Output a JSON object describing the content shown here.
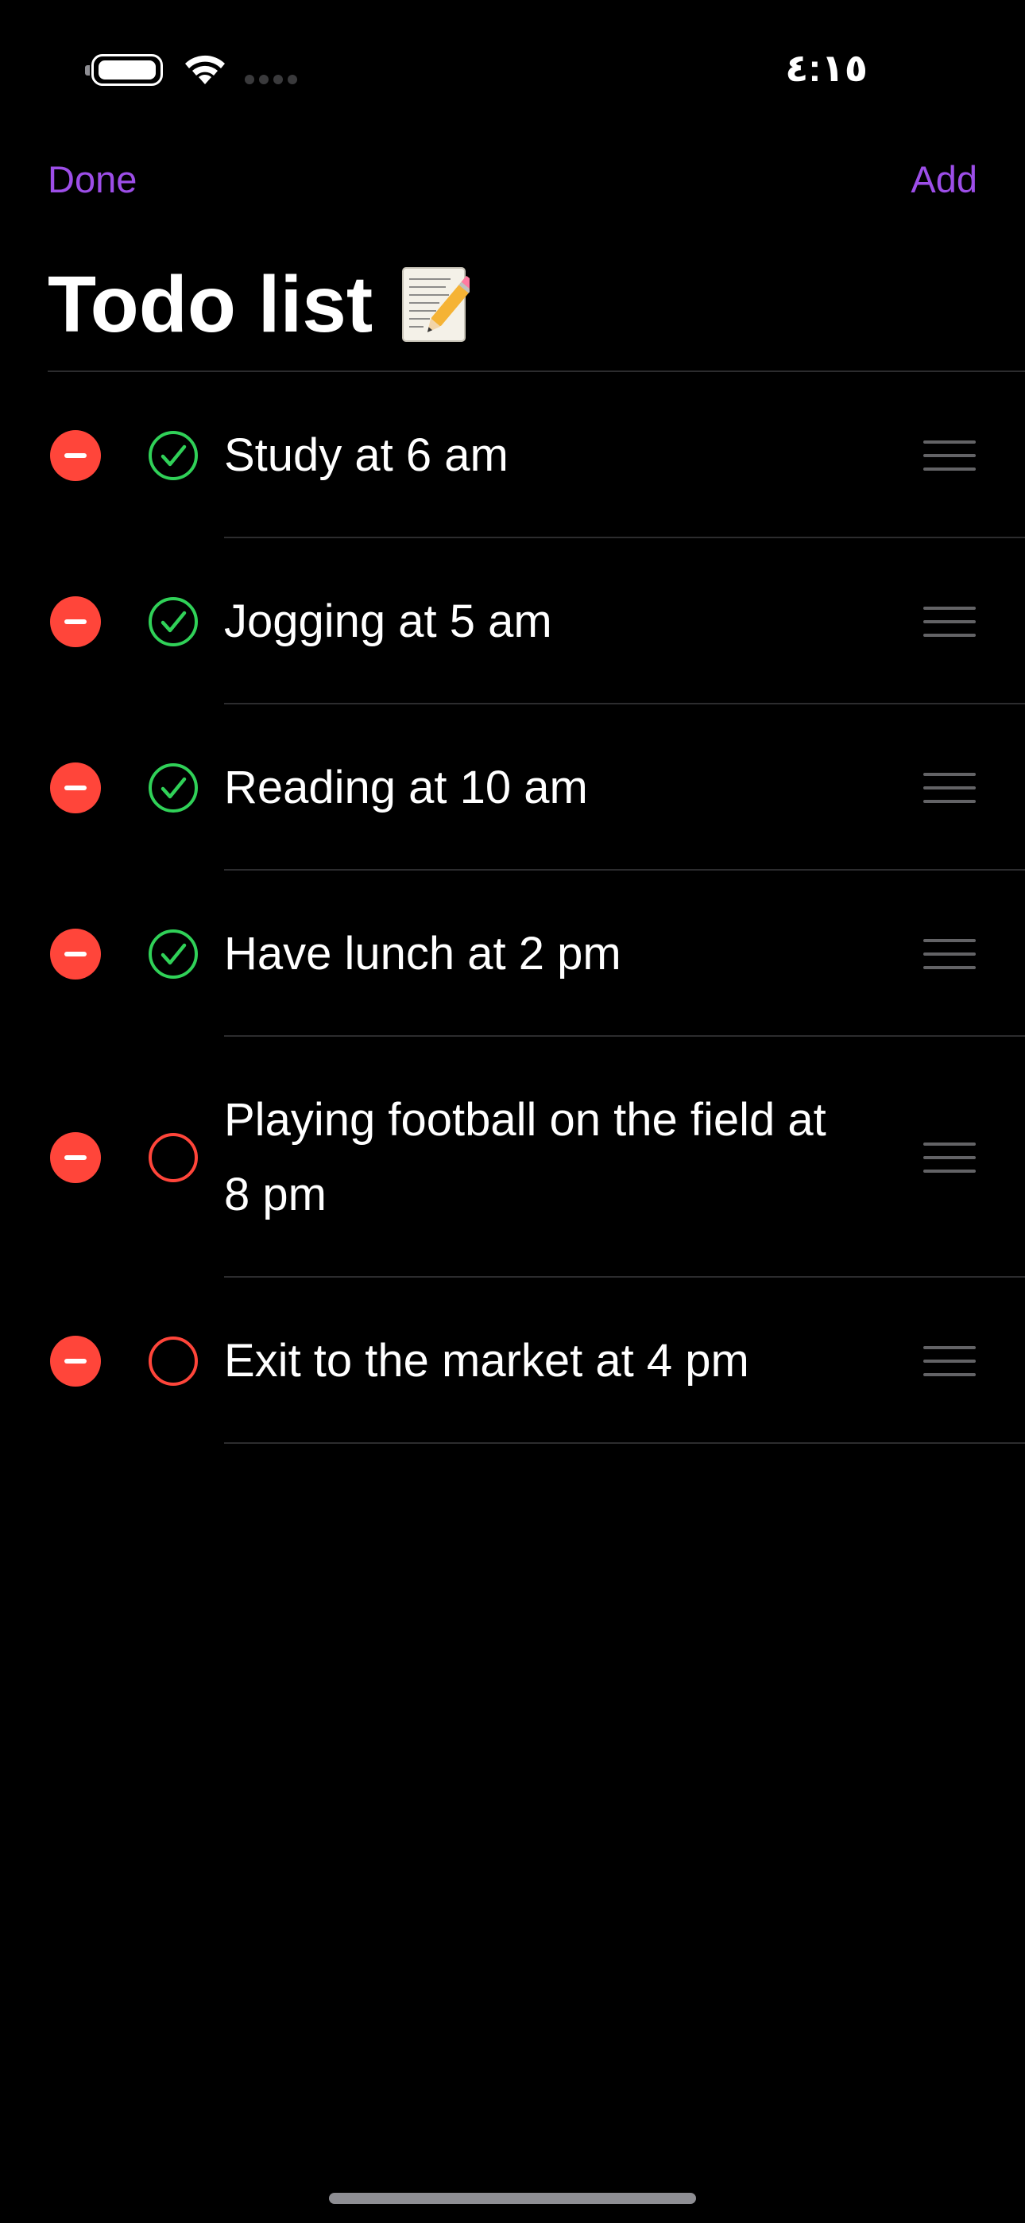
{
  "status_bar": {
    "time": "٤:١٥",
    "battery_icon": "battery-icon",
    "wifi_icon": "wifi-icon",
    "signal_icon": "cellular-signal-icon"
  },
  "nav": {
    "done_label": "Done",
    "add_label": "Add",
    "accent_color": "#9d4ee8"
  },
  "page": {
    "title": "Todo list",
    "title_icon": "memo-icon"
  },
  "todos": [
    {
      "label": "Study at 6 am",
      "done": true
    },
    {
      "label": "Jogging at 5 am",
      "done": true
    },
    {
      "label": "Reading at 10 am",
      "done": true
    },
    {
      "label": "Have lunch at 2 pm",
      "done": true
    },
    {
      "label": "Playing football on the field at 8 pm",
      "done": false
    },
    {
      "label": "Exit to the market at 4 pm",
      "done": false
    }
  ],
  "colors": {
    "background": "#000000",
    "delete": "#ff453a",
    "done": "#30d158",
    "pending": "#ff453a",
    "separator": "#2c2c2e"
  }
}
